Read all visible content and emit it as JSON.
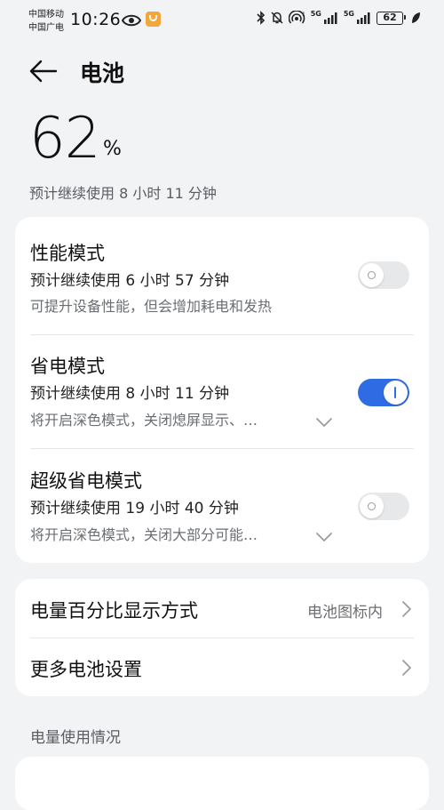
{
  "status_bar": {
    "carrier_line1": "中国移动",
    "carrier_line2": "中国广电",
    "time": "10:26",
    "sim1_tag": "5G",
    "sim2_tag": "5G",
    "battery_level": "62",
    "icons": [
      "eye-icon",
      "app-notification-icon",
      "bluetooth-icon",
      "mute-icon",
      "hotspot-icon",
      "signal-icon",
      "signal-icon",
      "battery-icon",
      "leaf-icon"
    ]
  },
  "header": {
    "title": "电池"
  },
  "battery": {
    "percent": "62",
    "percent_symbol": "%",
    "estimate": "预计继续使用 8 小时 11 分钟"
  },
  "modes": [
    {
      "title": "性能模式",
      "estimate": "预计继续使用 6 小时 57 分钟",
      "description": "可提升设备性能，但会增加耗电和发热",
      "enabled": false
    },
    {
      "title": "省电模式",
      "estimate": "预计继续使用 8 小时 11 分钟",
      "description": "将开启深色模式，关闭熄屏显示、…",
      "enabled": true
    },
    {
      "title": "超级省电模式",
      "estimate": "预计继续使用 19 小时 40 分钟",
      "description": "将开启深色模式，关闭大部分可能…",
      "enabled": false
    }
  ],
  "settings": {
    "display_mode_label": "电量百分比显示方式",
    "display_mode_value": "电池图标内",
    "more_settings_label": "更多电池设置"
  },
  "usage_section": {
    "label": "电量使用情况"
  },
  "colors": {
    "background": "#f1f3f5",
    "card": "#ffffff",
    "accent": "#2f6ce3",
    "toggle_off": "#e7e8ea",
    "secondary_text": "#6b6e72"
  }
}
